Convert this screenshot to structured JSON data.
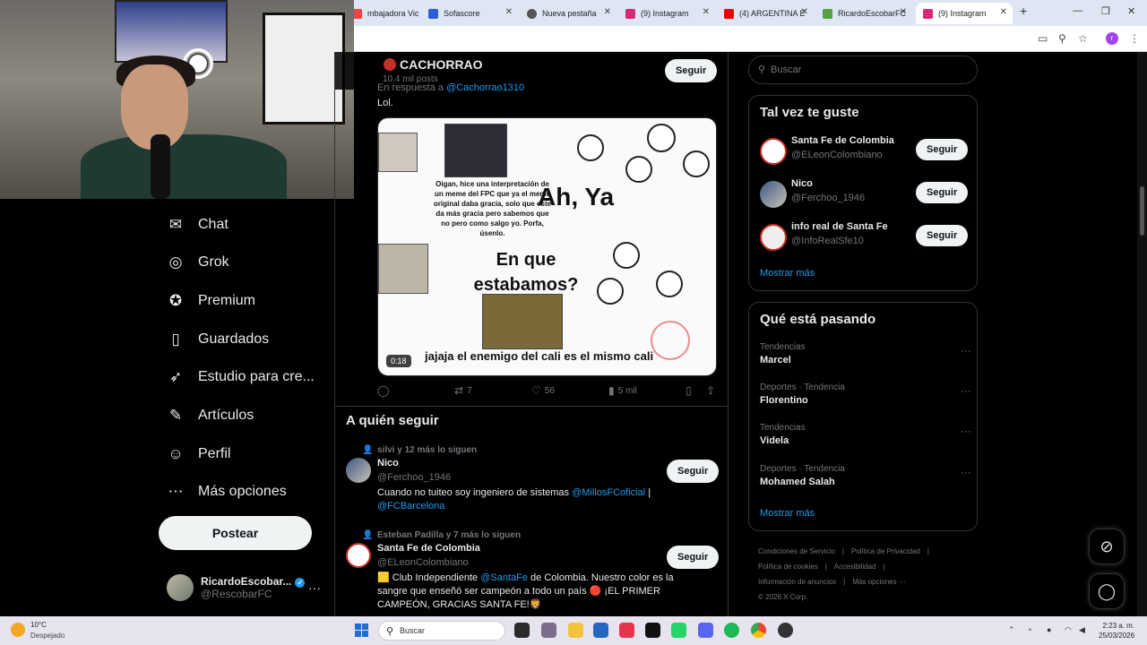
{
  "browser": {
    "tabs": [
      {
        "label": "mbajadora Vic",
        "color": "#e44"
      },
      {
        "label": "Sofascore",
        "color": "#2b5fd9"
      },
      {
        "label": "Nueva pestaña",
        "color": "#555"
      },
      {
        "label": "(9) Instagram",
        "color": "#d62976"
      },
      {
        "label": "(4) ARGENTINA E",
        "color": "#e00"
      },
      {
        "label": "RicardoEscobarFC",
        "color": "#53a23f"
      },
      {
        "label": "(9) Instagram",
        "color": "#d62976"
      }
    ],
    "new_tab": "+",
    "profile_initial": "r"
  },
  "nav": {
    "items": [
      {
        "label": "Chat",
        "icon": "mail-icon",
        "glyph": "✉"
      },
      {
        "label": "Grok",
        "icon": "grok-icon",
        "glyph": "◎"
      },
      {
        "label": "Premium",
        "icon": "premium-icon",
        "glyph": "✪"
      },
      {
        "label": "Guardados",
        "icon": "bookmark-icon",
        "glyph": "▯"
      },
      {
        "label": "Estudio para cre...",
        "icon": "rocket-icon",
        "glyph": "➶"
      },
      {
        "label": "Artículos",
        "icon": "article-icon",
        "glyph": "✎"
      },
      {
        "label": "Perfil",
        "icon": "person-icon",
        "glyph": "☺"
      },
      {
        "label": "Más opciones",
        "icon": "more-icon",
        "glyph": "⋯"
      }
    ],
    "post_button": "Postear",
    "account": {
      "name": "RicardoEscobar...",
      "handle": "@RescobarFC",
      "more": "···"
    }
  },
  "profile_header": {
    "name": "CACHORRAO",
    "count": "10,4 mil posts",
    "follow": "Seguir"
  },
  "tweet": {
    "reply_prefix": "En respuesta a",
    "reply_handle": "@Cachorrao1310",
    "text": "Lol.",
    "media": {
      "caption": "Oigan, hice una interpretación de un meme del FPC que ya el meme original daba gracia, solo que este da más gracia pero sabemos que no pero como salgo yo. Porfa, úsenlo.",
      "big_text_1": "Ah, Ya",
      "big_text_2": "En que estabamos?",
      "bottom_text": "jajaja el enemigo del cali es el mismo cali",
      "duration": "0:18"
    },
    "actions": {
      "reposts": "7",
      "likes": "56",
      "views": "5 mil"
    }
  },
  "who_to_follow": {
    "title": "A quién seguir",
    "users": [
      {
        "context": "silvi y 12 más lo siguen",
        "name": "Nico",
        "handle": "@Ferchoo_1946",
        "bio_text": "Cuando no tuiteo soy ingeniero de sistemas ",
        "bio_link1": "@MillosFCoficial",
        "bio_sep": " | ",
        "bio_link2": "@FCBarcelona",
        "follow": "Seguir"
      },
      {
        "context": "Esteban Padilla y 7 más lo siguen",
        "name": "Santa Fe de Colombia",
        "handle": "@ELeonColombiano",
        "bio_pre": "🟨 Club Independiente ",
        "bio_link": "@SantaFe",
        "bio_post": " de Colombia. Nuestro color es la sangre que enseñó ser campeón a todo un país 🔴 ¡EL PRIMER CAMPEÓN, GRACIAS SANTA FE!🦁",
        "follow": "Seguir"
      }
    ]
  },
  "search": {
    "placeholder": "Buscar"
  },
  "suggestions": {
    "title": "Tal vez te guste",
    "users": [
      {
        "name": "Santa Fe de Colombia",
        "handle": "@ELeonColombiano",
        "follow": "Seguir"
      },
      {
        "name": "Nico",
        "handle": "@Ferchoo_1946",
        "follow": "Seguir"
      },
      {
        "name": "info real de Santa Fe",
        "handle": "@InfoRealSfe10",
        "follow": "Seguir"
      }
    ],
    "more": "Mostrar más"
  },
  "trends": {
    "title": "Qué está pasando",
    "items": [
      {
        "category": "Tendencias",
        "name": "Marcel"
      },
      {
        "category": "Deportes · Tendencia",
        "name": "Florentino"
      },
      {
        "category": "Tendencias",
        "name": "Videla"
      },
      {
        "category": "Deportes · Tendencia",
        "name": "Mohamed Salah"
      }
    ],
    "more": "Mostrar más"
  },
  "footer": {
    "links": [
      "Condiciones de Servicio",
      "|",
      "Política de Privacidad",
      "|",
      "Política de cookies",
      "|",
      "Accesibilidad",
      "|",
      "Información de anuncios",
      "|",
      "Más opciones ···"
    ],
    "copyright": "© 2026 X Corp."
  },
  "taskbar": {
    "weather_temp": "10°C",
    "weather_cond": "Despejado",
    "search_placeholder": "Buscar",
    "time": "2:23 a. m.",
    "date": "25/03/2026"
  }
}
